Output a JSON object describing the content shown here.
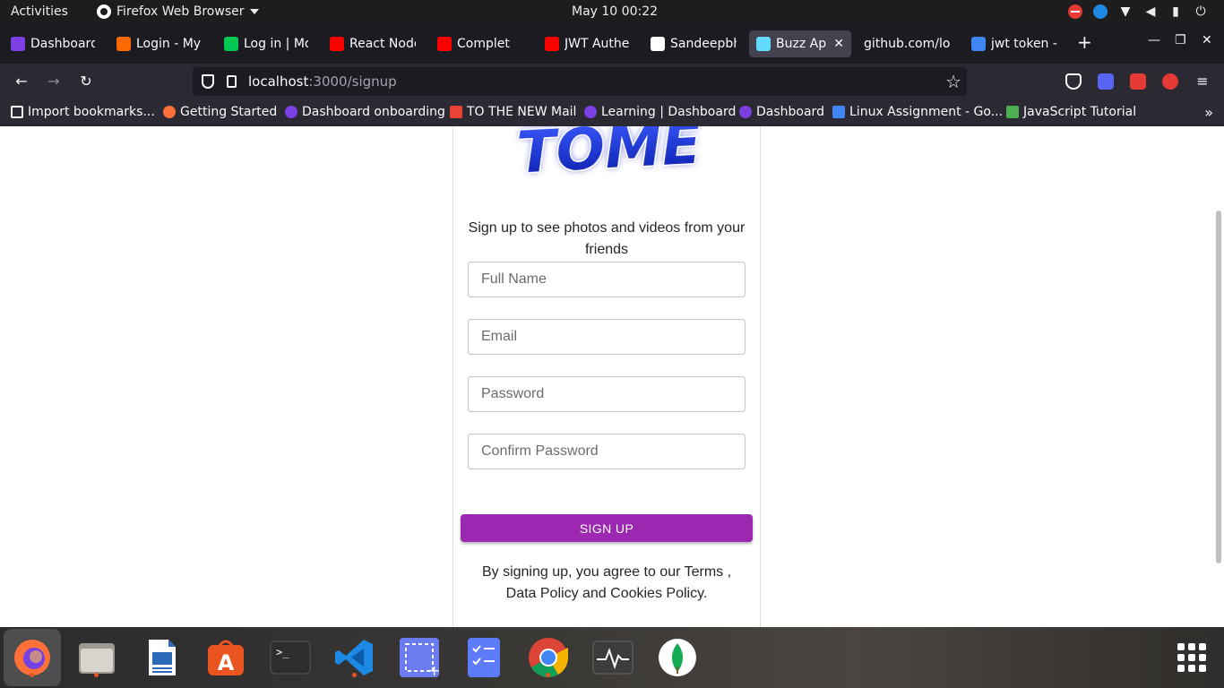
{
  "topbar": {
    "activities": "Activities",
    "app_name": "Firefox Web Browser",
    "clock": "May 10  00:22"
  },
  "tabs": [
    {
      "label": "Dashboard",
      "color": "#7b3fe4"
    },
    {
      "label": "Login - My",
      "color": "#ff6a00"
    },
    {
      "label": "Log in | Mo",
      "color": "#00c853"
    },
    {
      "label": "React Node",
      "color": "#ff0000"
    },
    {
      "label": "Complet",
      "color": "#ff0000"
    },
    {
      "label": "JWT Authe",
      "color": "#ff0000"
    },
    {
      "label": "Sandeepbh",
      "color": "#ffffff"
    },
    {
      "label": "Buzz App",
      "color": "#61dafb",
      "active": true
    },
    {
      "label": "github.com/lo",
      "color": "#1c1b22"
    },
    {
      "label": "jwt token -",
      "color": "#4285f4"
    }
  ],
  "navbar": {
    "url_host": "localhost",
    "url_rest": ":3000/signup"
  },
  "bookmarks": [
    {
      "label": "Import bookmarks...",
      "color": "#fbfbfe"
    },
    {
      "label": "Getting Started",
      "color": "#ff7139"
    },
    {
      "label": "Dashboard onboarding",
      "color": "#7b3fe4"
    },
    {
      "label": "TO THE NEW Mail",
      "color": "#ea4335"
    },
    {
      "label": "Learning | Dashboard",
      "color": "#7b3fe4"
    },
    {
      "label": "Dashboard",
      "color": "#7b3fe4"
    },
    {
      "label": "Linux Assignment - Go...",
      "color": "#4285f4"
    },
    {
      "label": "JavaScript Tutorial",
      "color": "#4caf50"
    }
  ],
  "page": {
    "logo_text": "TOME",
    "tagline": "Sign up to see photos and videos from your friends",
    "fields": {
      "full_name": "Full Name",
      "email": "Email",
      "password": "Password",
      "confirm_password": "Confirm Password"
    },
    "signup_label": "SIGN UP",
    "terms": "By signing up, you agree to our Terms , Data Policy and Cookies Policy."
  },
  "dock": [
    {
      "name": "firefox",
      "color": "#ff7139",
      "running": true
    },
    {
      "name": "files",
      "color": "#9e9a92",
      "running": true
    },
    {
      "name": "libreoffice-writer",
      "color": "#2a6ab8",
      "running": false
    },
    {
      "name": "software-center",
      "color": "#e95420",
      "running": false
    },
    {
      "name": "terminal",
      "color": "#3a3a3a",
      "running": false
    },
    {
      "name": "vscode",
      "color": "#1e88e5",
      "running": true
    },
    {
      "name": "screenshot",
      "color": "#6b7cf0",
      "running": false
    },
    {
      "name": "tasks",
      "color": "#5c7cfa",
      "running": false
    },
    {
      "name": "chrome",
      "color": "#db4437",
      "running": true
    },
    {
      "name": "system-monitor",
      "color": "#444",
      "running": false
    },
    {
      "name": "mongodb-compass",
      "color": "#ffffff",
      "running": false
    }
  ]
}
